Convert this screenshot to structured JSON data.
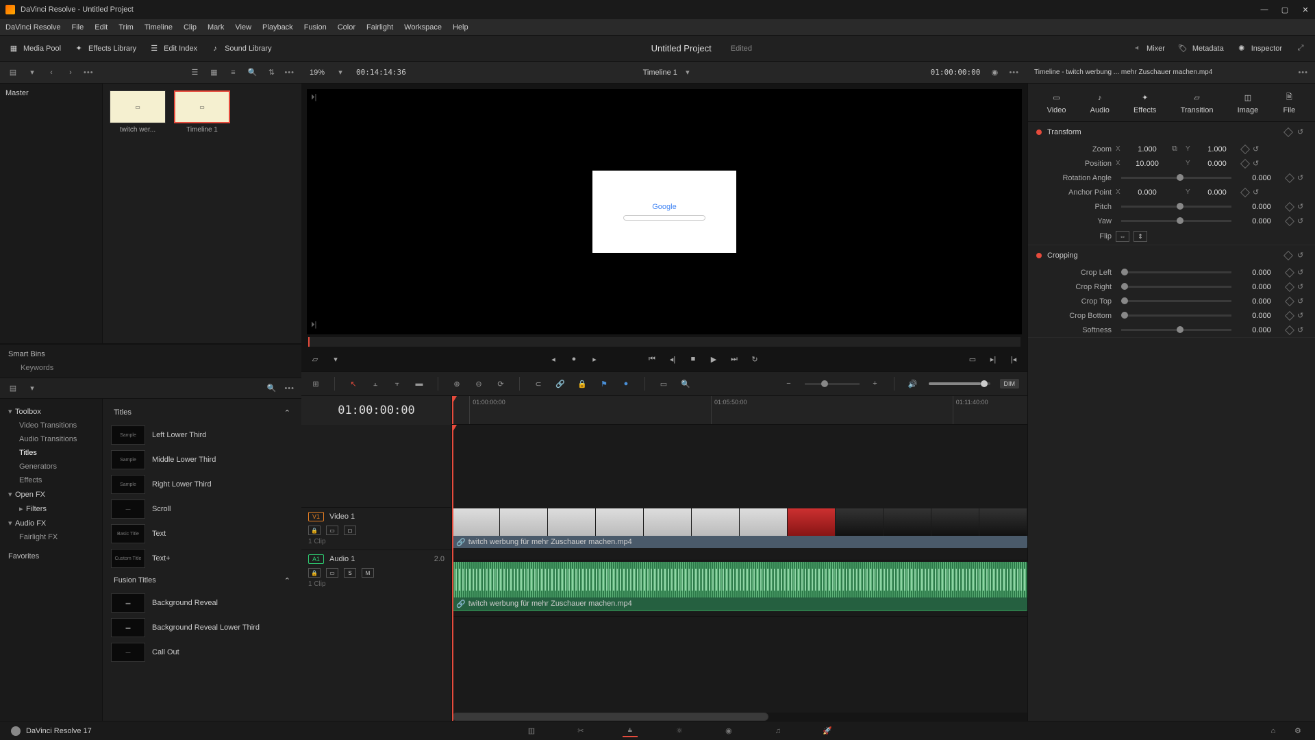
{
  "window": {
    "title": "DaVinci Resolve - Untitled Project"
  },
  "menu": [
    "DaVinci Resolve",
    "File",
    "Edit",
    "Trim",
    "Timeline",
    "Clip",
    "Mark",
    "View",
    "Playback",
    "Fusion",
    "Color",
    "Fairlight",
    "Workspace",
    "Help"
  ],
  "toolbar": {
    "media_pool": "Media Pool",
    "effects_library": "Effects Library",
    "edit_index": "Edit Index",
    "sound_library": "Sound Library",
    "mixer": "Mixer",
    "metadata": "Metadata",
    "inspector": "Inspector",
    "project": "Untitled Project",
    "edited": "Edited"
  },
  "subbar": {
    "zoom_pct": "19%",
    "source_tc": "00:14:14:36",
    "timeline_name": "Timeline 1",
    "record_tc": "01:00:00:00",
    "inspector_title": "Timeline - twitch werbung ... mehr Zuschauer machen.mp4"
  },
  "media": {
    "master": "Master",
    "clips": [
      {
        "name": "twitch wer..."
      },
      {
        "name": "Timeline 1"
      }
    ],
    "smart_bins": "Smart Bins",
    "keywords": "Keywords"
  },
  "fx_tree": {
    "toolbox": "Toolbox",
    "video_transitions": "Video Transitions",
    "audio_transitions": "Audio Transitions",
    "titles": "Titles",
    "generators": "Generators",
    "effects": "Effects",
    "open_fx": "Open FX",
    "filters": "Filters",
    "audio_fx": "Audio FX",
    "fairlight_fx": "Fairlight FX",
    "favorites": "Favorites"
  },
  "fx_list": {
    "cat_titles": "Titles",
    "items": [
      "Left Lower Third",
      "Middle Lower Third",
      "Right Lower Third",
      "Scroll",
      "Text",
      "Text+"
    ],
    "cat_fusion": "Fusion Titles",
    "fusion_items": [
      "Background Reveal",
      "Background Reveal Lower Third",
      "Call Out"
    ]
  },
  "viewer": {
    "preview_text": "Google"
  },
  "timeline": {
    "tc": "01:00:00:00",
    "ruler": [
      "01:00:00:00",
      "01:05:50:00",
      "01:11:40:00"
    ],
    "video_track": {
      "tag": "V1",
      "name": "Video 1",
      "clips": "1 Clip"
    },
    "audio_track": {
      "tag": "A1",
      "name": "Audio 1",
      "level": "2.0",
      "clips": "1 Clip"
    },
    "clip_name": "twitch werbung für mehr Zuschauer machen.mp4"
  },
  "tools": {
    "dim": "DIM"
  },
  "inspector": {
    "tabs": {
      "video": "Video",
      "audio": "Audio",
      "effects": "Effects",
      "transition": "Transition",
      "image": "Image",
      "file": "File"
    },
    "transform": "Transform",
    "cropping": "Cropping",
    "props": {
      "zoom": "Zoom",
      "zoom_x": "1.000",
      "zoom_y": "1.000",
      "position": "Position",
      "pos_x": "10.000",
      "pos_y": "0.000",
      "rotation": "Rotation Angle",
      "rot_v": "0.000",
      "anchor": "Anchor Point",
      "anc_x": "0.000",
      "anc_y": "0.000",
      "pitch": "Pitch",
      "pitch_v": "0.000",
      "yaw": "Yaw",
      "yaw_v": "0.000",
      "flip": "Flip",
      "crop_left": "Crop Left",
      "crop_left_v": "0.000",
      "crop_right": "Crop Right",
      "crop_right_v": "0.000",
      "crop_top": "Crop Top",
      "crop_top_v": "0.000",
      "crop_bottom": "Crop Bottom",
      "crop_bottom_v": "0.000",
      "softness": "Softness",
      "softness_v": "0.000"
    }
  },
  "footer": {
    "version": "DaVinci Resolve 17"
  }
}
